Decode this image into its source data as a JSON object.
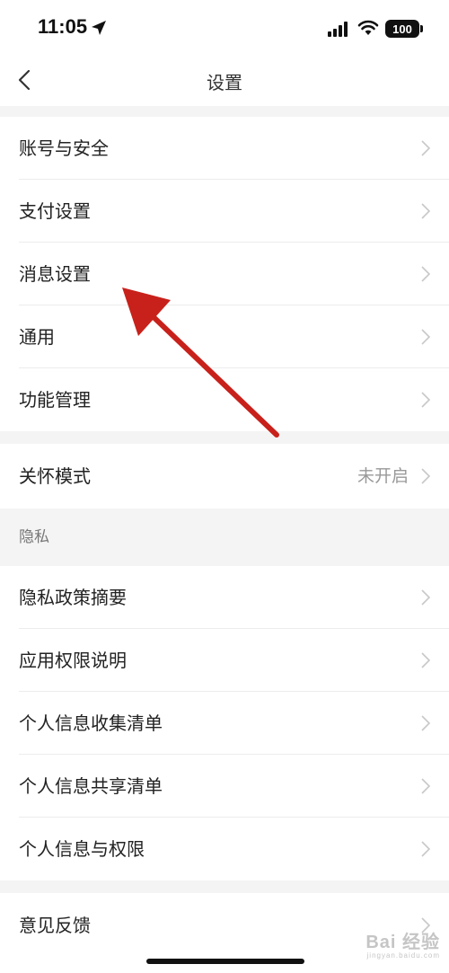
{
  "status_bar": {
    "time": "11:05",
    "battery": "100"
  },
  "nav": {
    "title": "设置"
  },
  "group1": [
    {
      "label": "账号与安全"
    },
    {
      "label": "支付设置"
    },
    {
      "label": "消息设置"
    },
    {
      "label": "通用"
    },
    {
      "label": "功能管理"
    }
  ],
  "group2": [
    {
      "label": "关怀模式",
      "value": "未开启"
    }
  ],
  "privacy": {
    "header": "隐私",
    "items": [
      {
        "label": "隐私政策摘要"
      },
      {
        "label": "应用权限说明"
      },
      {
        "label": "个人信息收集清单"
      },
      {
        "label": "个人信息共享清单"
      },
      {
        "label": "个人信息与权限"
      }
    ]
  },
  "group4": [
    {
      "label": "意见反馈"
    }
  ],
  "watermark": {
    "text": "Bai 经验",
    "sub": "jingyan.baidu.com"
  },
  "colors": {
    "annotation_arrow": "#c8211b",
    "gap": "#f4f4f4"
  }
}
